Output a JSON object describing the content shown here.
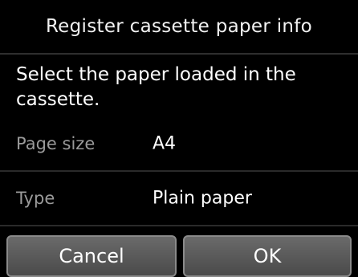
{
  "header": {
    "title": "Register cassette paper info"
  },
  "instruction": "Select the paper loaded in the cassette.",
  "settings": [
    {
      "label": "Page size",
      "value": "A4"
    },
    {
      "label": "Type",
      "value": "Plain paper"
    }
  ],
  "buttons": {
    "cancel": "Cancel",
    "ok": "OK"
  }
}
